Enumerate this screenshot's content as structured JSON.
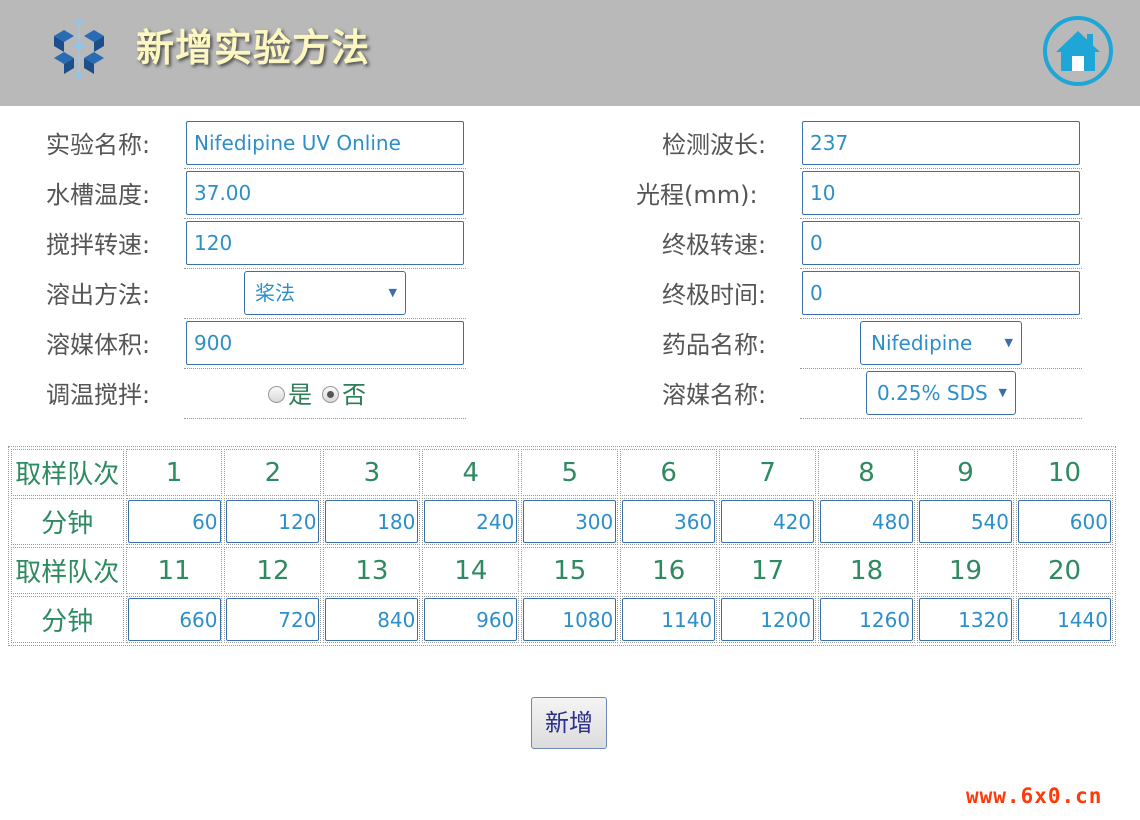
{
  "header": {
    "title": "新增实验方法",
    "logo_icon": "cube-network-icon",
    "home_icon": "home-icon",
    "home_color": "#1ea6d6"
  },
  "form": {
    "experiment_name": {
      "label": "实验名称:",
      "value": "Nifedipine UV Online"
    },
    "bath_temp": {
      "label": "水槽温度:",
      "value": "37.00"
    },
    "stir_speed": {
      "label": "搅拌转速:",
      "value": "120"
    },
    "dissolution_method": {
      "label": "溶出方法:",
      "value": "桨法"
    },
    "medium_volume": {
      "label": "溶媒体积:",
      "value": "900"
    },
    "temp_stir": {
      "label": "调温搅拌:",
      "options": [
        "是",
        "否"
      ],
      "selected": "否"
    },
    "wavelength": {
      "label": "检测波长:",
      "value": "237"
    },
    "path_length": {
      "label": "光程(mm):",
      "value": "10"
    },
    "final_speed": {
      "label": "终极转速:",
      "value": "0"
    },
    "final_time": {
      "label": "终极时间:",
      "value": "0"
    },
    "drug_name": {
      "label": "药品名称:",
      "value": "Nifedipine"
    },
    "medium_name": {
      "label": "溶媒名称:",
      "value": "0.25% SDS"
    }
  },
  "sampling": {
    "seq_label": "取样队次",
    "minute_label": "分钟",
    "row1_seq": [
      "1",
      "2",
      "3",
      "4",
      "5",
      "6",
      "7",
      "8",
      "9",
      "10"
    ],
    "row1_min": [
      "60",
      "120",
      "180",
      "240",
      "300",
      "360",
      "420",
      "480",
      "540",
      "600"
    ],
    "row2_seq": [
      "11",
      "12",
      "13",
      "14",
      "15",
      "16",
      "17",
      "18",
      "19",
      "20"
    ],
    "row2_min": [
      "660",
      "720",
      "840",
      "960",
      "1080",
      "1140",
      "1200",
      "1260",
      "1320",
      "1440"
    ]
  },
  "actions": {
    "add_label": "新增"
  },
  "watermark": "www.6x0.cn"
}
